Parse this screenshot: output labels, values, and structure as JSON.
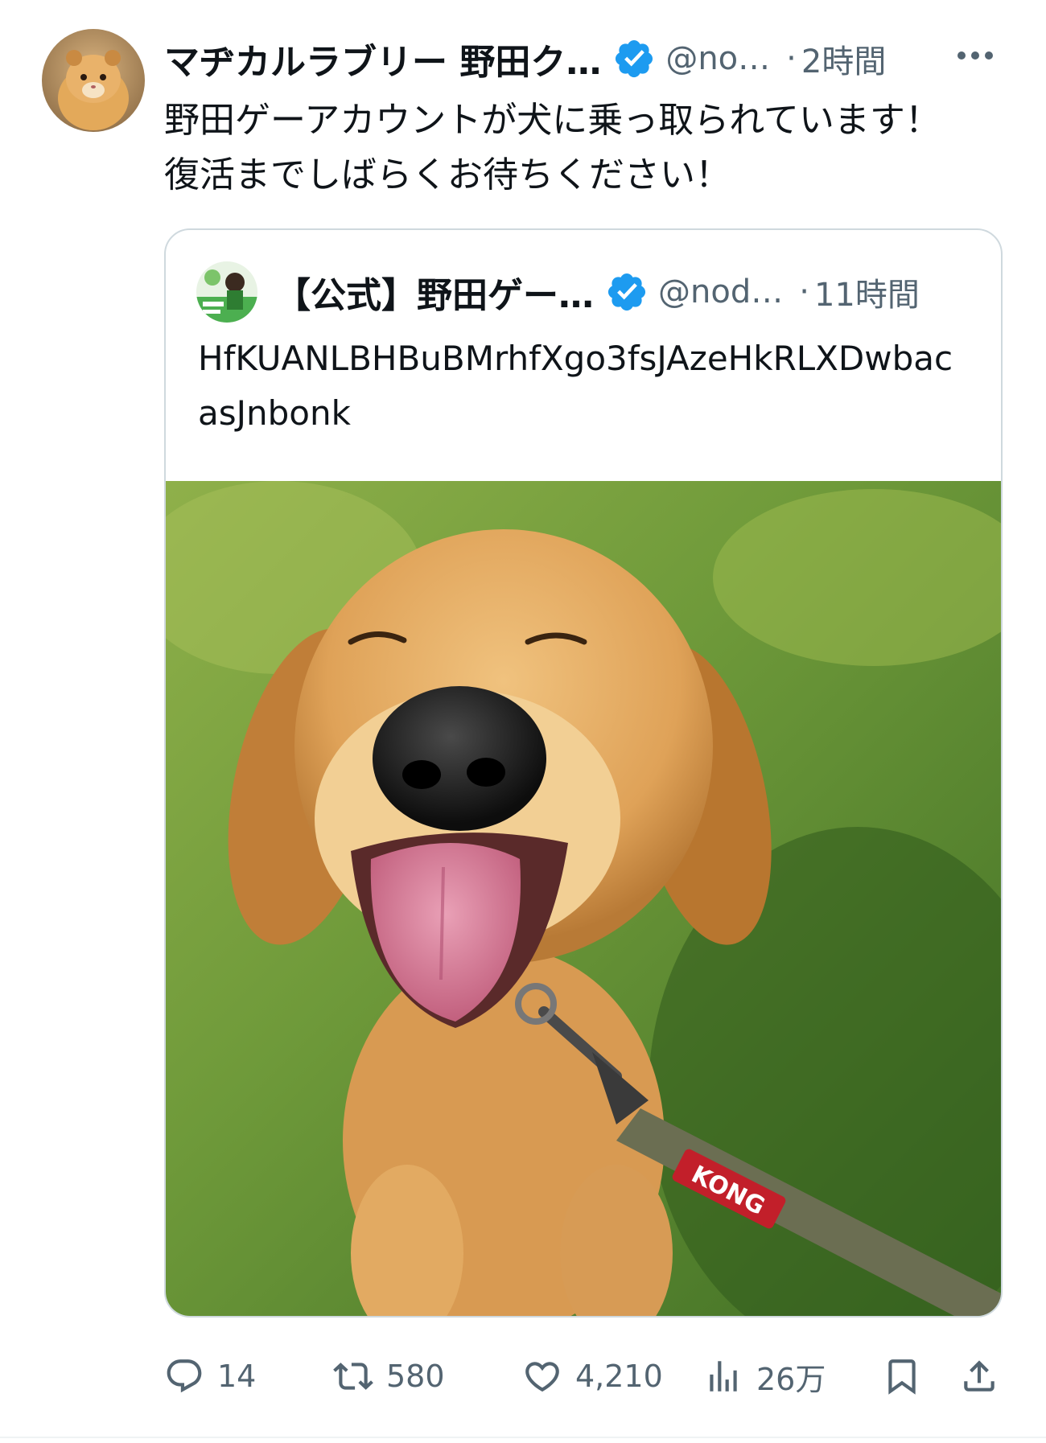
{
  "tweet": {
    "author_name": "マヂカルラブリー 野田ク…",
    "handle": "@no…",
    "separator": "·",
    "time": "2時間",
    "text_lines": [
      "野田ゲーアカウントが犬に乗っ取られています！",
      "復活までしばらくお待ちください！"
    ]
  },
  "quote": {
    "author_name": "【公式】野田ゲー…",
    "handle": "@nod…",
    "separator": "·",
    "time": "11時間",
    "text_lines": [
      "HfKUANLBHBuBMrhfXgo3fsJAzeHkRLXDwbac",
      "asJnbonk"
    ],
    "media_leash_text": "KONG"
  },
  "actions": {
    "replies": "14",
    "retweets": "580",
    "likes": "4,210",
    "views": "26万"
  },
  "colors": {
    "verified": "#1d9bf0",
    "secondary_text": "#536471",
    "border": "#cfd9de"
  },
  "icons": [
    "more-icon",
    "verified-icon",
    "reply-icon",
    "retweet-icon",
    "like-icon",
    "views-icon",
    "bookmark-icon",
    "share-icon"
  ]
}
